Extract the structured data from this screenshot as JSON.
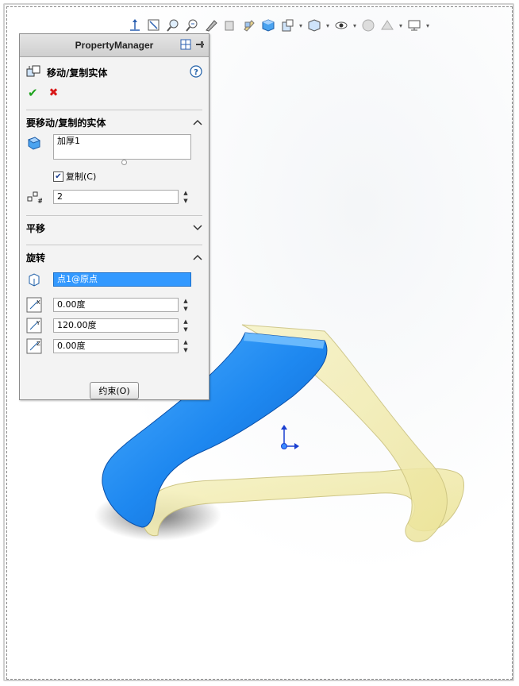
{
  "property_manager": {
    "title": "PropertyManager",
    "feature_title": "移动/复制实体",
    "ok_symbol": "✔",
    "cancel_symbol": "✖",
    "group_bodies": {
      "title": "要移动/复制的实体",
      "selection": "加厚1",
      "copy_label": "复制(C)",
      "copy_checked": true,
      "copies_value": "2"
    },
    "group_translate": {
      "title": "平移"
    },
    "group_rotate": {
      "title": "旋转",
      "origin_selection": "点1@原点",
      "angle_x": "0.00度",
      "angle_y": "120.00度",
      "angle_z": "0.00度"
    },
    "constraints_button": "约束(O)"
  },
  "icons": {
    "toolbar": [
      "view-orientation-icon",
      "zoom-to-fit-icon",
      "zoom-area-icon",
      "previous-view-icon",
      "section-view-icon",
      "dynamic-annotation-icon",
      "view-settings-icon",
      "display-style-icon",
      "hide-show-icon",
      "edit-appearance-icon",
      "apply-scene-icon",
      "view-setting-monitor-icon"
    ]
  },
  "colors": {
    "blue_body": "#1e88f0",
    "yellow_copy": "#f3efb0",
    "arrow_red": "#e0242c",
    "selection_blue": "#3399ff"
  }
}
